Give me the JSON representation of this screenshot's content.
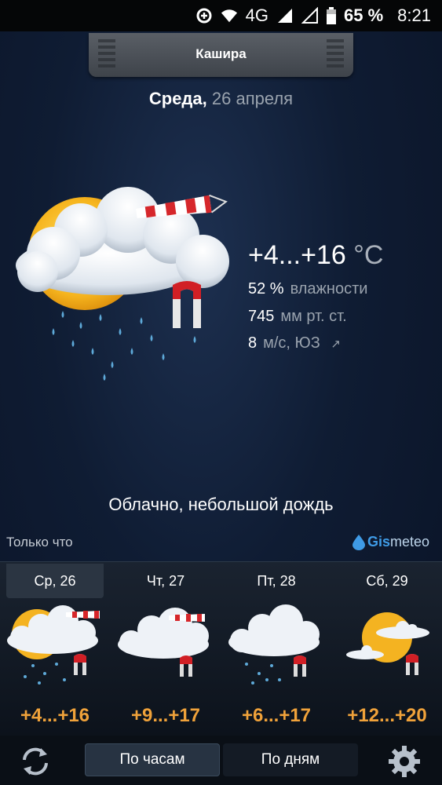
{
  "status_bar": {
    "network": "4G",
    "battery": "65 %",
    "time": "8:21"
  },
  "location": {
    "title": "Кашира"
  },
  "current": {
    "day": "Среда,",
    "date": "26 апреля",
    "temp": "+4...+16",
    "temp_unit": "°C",
    "humidity_value": "52 %",
    "humidity_label": "влажности",
    "pressure_value": "745",
    "pressure_label": "мм рт. ст.",
    "wind_value": "8",
    "wind_label": "м/с, ЮЗ",
    "wind_arrow": "↗",
    "condition": "Облачно, небольшой дождь",
    "updated": "Только что",
    "icon": "cloud-sun-rain-wind-icon"
  },
  "brand": {
    "part1": "Gis",
    "part2": "meteo"
  },
  "forecast": [
    {
      "label": "Ср, 26",
      "temp": "+4...+16",
      "icon": "cloud-sun-rain-wind-icon",
      "selected": true
    },
    {
      "label": "Чт, 27",
      "temp": "+9...+17",
      "icon": "cloud-wind-icon",
      "selected": false
    },
    {
      "label": "Пт, 28",
      "temp": "+6...+17",
      "icon": "cloud-rain-icon",
      "selected": false
    },
    {
      "label": "Сб, 29",
      "temp": "+12...+20",
      "icon": "sun-cloud-icon",
      "selected": false
    }
  ],
  "bottom": {
    "hourly_label": "По часам",
    "daily_label": "По дням"
  },
  "colors": {
    "forecast_temp": "#f0a23a",
    "accent": "#3f9be6"
  }
}
